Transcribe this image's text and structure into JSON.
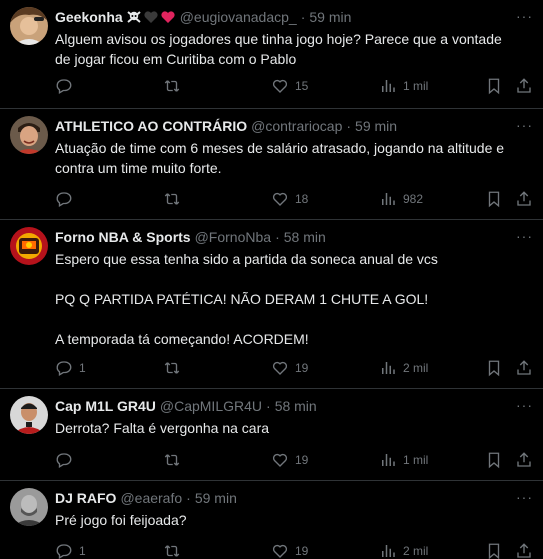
{
  "tweets": [
    {
      "name": "Geekonha",
      "handle": "@eugiovanadacp_",
      "time": "59 min",
      "text": "Alguem avisou os jogadores que tinha jogo hoje? Parece que a vontade de jogar ficou em Curitiba com o Pablo",
      "replies": "",
      "retweets": "",
      "likes": "15",
      "views": "1 mil",
      "emojis": [
        "skull-crossbones-icon",
        "black-heart-icon",
        "red-heart-icon"
      ]
    },
    {
      "name": "ATHLETICO AO CONTRÁRIO",
      "handle": "@contrariocap",
      "time": "59 min",
      "text": "Atuação de time com 6 meses de salário atrasado, jogando na altitude e contra um time muito forte.",
      "replies": "",
      "retweets": "",
      "likes": "18",
      "views": "982"
    },
    {
      "name": "Forno NBA & Sports",
      "handle": "@FornoNba",
      "time": "58 min",
      "text": "Espero que essa tenha sido a partida da soneca anual de vcs\n\nPQ Q PARTIDA PATÉTICA! NÃO DERAM 1 CHUTE A GOL!\n\nA temporada tá começando! ACORDEM!",
      "replies": "1",
      "retweets": "",
      "likes": "19",
      "views": "2 mil"
    },
    {
      "name": "Cap M1L GR4U",
      "handle": "@CapMILGR4U",
      "time": "58 min",
      "text": "Derrota? Falta é vergonha na cara",
      "replies": "",
      "retweets": "",
      "likes": "19",
      "views": "1 mil"
    },
    {
      "name": "DJ RAFO",
      "handle": "@eaerafo",
      "time": "59 min",
      "text": "Pré jogo foi feijoada?",
      "replies": "1",
      "retweets": "",
      "likes": "19",
      "views": "2 mil"
    }
  ],
  "more_label": "···",
  "dot": "·",
  "colors": {
    "background": "#000000",
    "text": "#e7e9ea",
    "muted": "#71767b",
    "divider": "#2f3336"
  }
}
